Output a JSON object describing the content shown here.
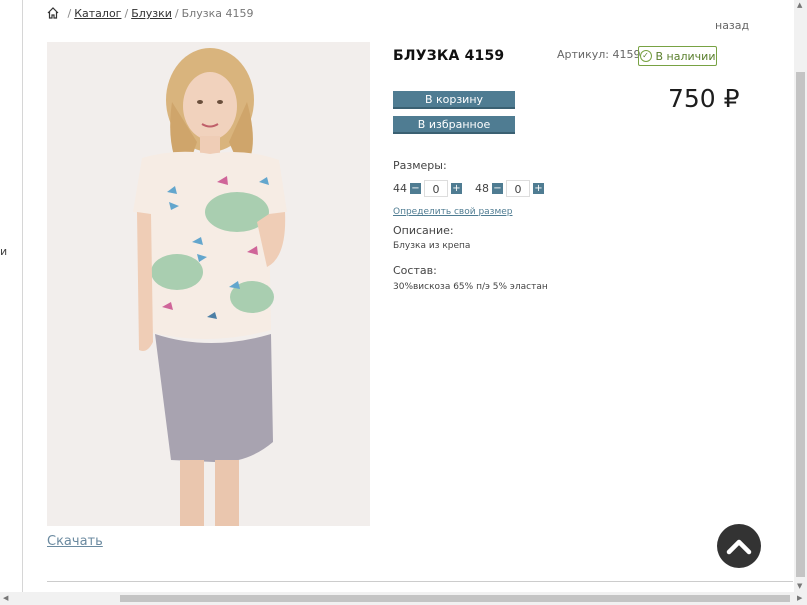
{
  "left_fragment": "и",
  "breadcrumb": {
    "items": [
      "Каталог",
      "Блузки"
    ],
    "current": "Блузка 4159",
    "separator": "/"
  },
  "back_link": "назад",
  "product": {
    "title": "БЛУЗКА 4159",
    "sku": "Артикул: 4159",
    "stock": "В наличии",
    "price": "750 ₽",
    "add_to_cart": "В корзину",
    "add_to_favorites": "В избранное",
    "sizes_label": "Размеры:",
    "sizes": [
      {
        "size": "44",
        "qty": "0"
      },
      {
        "size": "48",
        "qty": "0"
      }
    ],
    "size_help_link": "Определить свой размер",
    "description_label": "Описание:",
    "description": "Блузка из крепа",
    "composition_label": "Состав:",
    "composition": "30%вискоза 65% п/э 5% эластан",
    "download": "Скачать"
  },
  "colors": {
    "button": "#4f7c92",
    "stock_border": "#78a243",
    "link": "#6b8aa0"
  }
}
